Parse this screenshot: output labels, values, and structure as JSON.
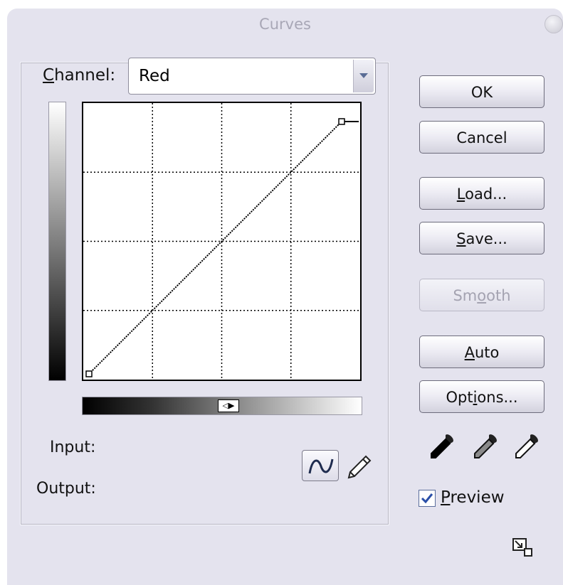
{
  "dialog": {
    "title": "Curves"
  },
  "channel": {
    "label_prefix": "C",
    "label_rest": "hannel:",
    "selected": "Red"
  },
  "graph": {
    "grid_divisions": 4,
    "curve_points": [
      [
        0,
        0
      ],
      [
        255,
        255
      ]
    ],
    "curve_color": "#000000"
  },
  "slider": {
    "handle_glyph": "◁▶"
  },
  "readouts": {
    "input_label": "Input:",
    "output_label": "Output:"
  },
  "buttons": {
    "ok": "OK",
    "cancel": "Cancel",
    "load_u": "L",
    "load_rest": "oad...",
    "save_u": "S",
    "save_rest": "ave...",
    "smooth_pre": "Sm",
    "smooth_u": "o",
    "smooth_rest": "oth",
    "auto_u": "A",
    "auto_rest": "uto",
    "options_pre": "Opt",
    "options_u": "i",
    "options_rest": "ons..."
  },
  "preview": {
    "checked": true,
    "label_u": "P",
    "label_rest": "review"
  },
  "colors": {
    "dialog_bg": "#e4e3ee",
    "title_text": "#a8a7b6",
    "check_mark": "#2a4fa8"
  },
  "icons": [
    "close-icon",
    "dropdown-arrow-icon",
    "curve-tool-icon",
    "pencil-icon",
    "black-eyedropper-icon",
    "gray-eyedropper-icon",
    "white-eyedropper-icon",
    "check-icon",
    "resize-icon"
  ]
}
